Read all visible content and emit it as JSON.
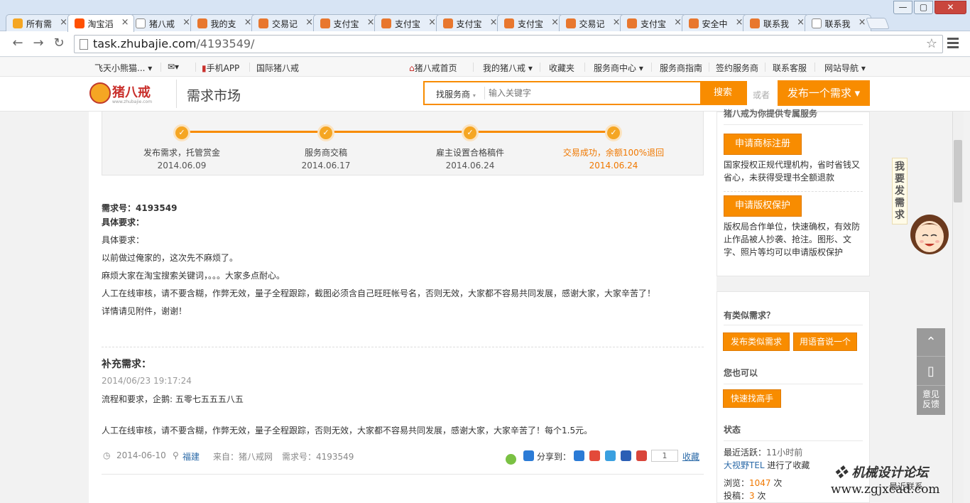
{
  "browser": {
    "tabs": [
      {
        "label": "所有需",
        "favicon": "pig-favicon"
      },
      {
        "label": "淘宝滔",
        "favicon": "taobao-favicon",
        "active": true
      },
      {
        "label": "猪八戒",
        "favicon": "page-favicon"
      },
      {
        "label": "我的支",
        "favicon": "alipay-favicon"
      },
      {
        "label": "交易记",
        "favicon": "alipay-favicon"
      },
      {
        "label": "支付宝",
        "favicon": "alipay-favicon"
      },
      {
        "label": "支付宝",
        "favicon": "alipay-favicon"
      },
      {
        "label": "支付宝",
        "favicon": "alipay-favicon"
      },
      {
        "label": "支付宝",
        "favicon": "alipay-favicon"
      },
      {
        "label": "交易记",
        "favicon": "alipay-favicon"
      },
      {
        "label": "支付宝",
        "favicon": "alipay-favicon"
      },
      {
        "label": "安全中",
        "favicon": "alipay-favicon"
      },
      {
        "label": "联系我",
        "favicon": "alipay-favicon"
      },
      {
        "label": "联系我",
        "favicon": "page-favicon"
      }
    ],
    "url_host": "task.zhubajie.com",
    "url_path": "/4193549/",
    "window_controls": {
      "minimize": "—",
      "maximize": "▢",
      "close": "✕"
    }
  },
  "sitetop": {
    "user": "飞天小熊猫...",
    "mobile_app": "手机APP",
    "intl": "国际猪八戒",
    "home": "猪八戒首页",
    "my": "我的猪八戒",
    "favorites": "收藏夹",
    "provider_center": "服务商中心",
    "provider_guide": "服务商指南",
    "signed": "签约服务商",
    "support": "联系客服",
    "sitenav": "网站导航"
  },
  "header": {
    "logo_text": "猪八戒",
    "logo_sub": "www.zhubajie.com",
    "market_title": "需求市场",
    "search_type": "找服务商",
    "search_placeholder": "输入关键字",
    "search_button": "搜索",
    "or_text": "或者",
    "post_button": "发布一个需求"
  },
  "progress": {
    "steps": [
      {
        "name": "发布需求，托管赏金",
        "date": "2014.06.09"
      },
      {
        "name": "服务商交稿",
        "date": "2014.06.17"
      },
      {
        "name": "雇主设置合格稿件",
        "date": "2014.06.24"
      },
      {
        "name": "交易成功，余额100%退回",
        "date": "2014.06.24"
      }
    ]
  },
  "task": {
    "id_line": "需求号：4193549",
    "req_heading": "具体要求：",
    "lines": [
      "具体要求：",
      "以前做过俺家的，这次先不麻烦了。",
      "麻烦大家在淘宝搜索关键词，。。。大家多点耐心。",
      "人工在线审核，请不要含糊，作弊无效，量子全程跟踪，截图必须含自己旺旺帐号名，否则无效，大家都不容易共同发展，感谢大家，大家辛苦了！",
      "详情请见附件，谢谢！"
    ]
  },
  "supplement": {
    "title": "补充需求：",
    "time": "2014/06/23 19:17:24",
    "line1": "流程和要求，企鹅: 五零七五五五八五",
    "line2": "人工在线审核，请不要含糊，作弊无效，量子全程跟踪，否则无效，大家都不容易共同发展，感谢大家，大家辛苦了！每个1.5元。"
  },
  "meta": {
    "date": "2014-06-10",
    "location": "福建",
    "source": "来自：猪八戒网",
    "task_no": "需求号：4193549",
    "share_label": "分享到：",
    "share_count": "1",
    "collect": "收藏"
  },
  "sidebar": {
    "top_cut": "猪八戒为你提供专属服务",
    "trademark_btn": "申请商标注册",
    "trademark_desc": "国家授权正规代理机构，省时省钱又省心，未获得受理书全额退款",
    "copyright_btn": "申请版权保护",
    "copyright_desc": "版权局合作单位，快速确权，有效防止作品被人抄袭、抢注。图形、文字、照片等均可以申请版权保护",
    "similar_title": "有类似需求？",
    "similar_btn": "发布类似需求",
    "voice_btn": "用语音说一个",
    "also_title": "您也可以",
    "expert_btn": "快速找高手",
    "status_title": "状态",
    "last_active_label": "最近活跃：",
    "last_active_value": "11小时前",
    "collector": "大视野TEL",
    "collector_action": " 进行了收藏",
    "views_label": "浏览：",
    "views_value": "1047",
    "views_unit": " 次",
    "bids_label": "投稿：",
    "bids_value": "3",
    "bids_unit": " 次"
  },
  "float": {
    "want_post": "我要发需求",
    "feedback": "意见反馈",
    "recent": "最近联系"
  },
  "watermark": {
    "line1": "机械设计论坛",
    "line2": "www.zgjxcad.com"
  },
  "colors": {
    "accent": "#f88c00",
    "success": "#f07800",
    "link": "#2b6aa8"
  }
}
